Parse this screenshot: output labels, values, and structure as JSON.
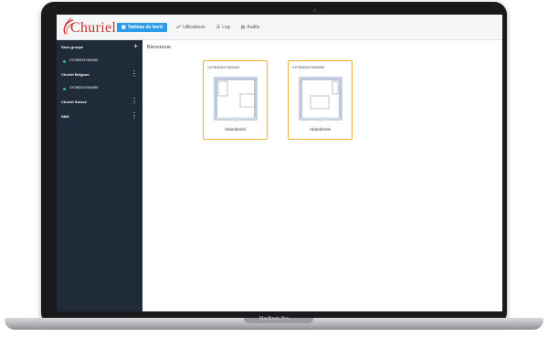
{
  "app": {
    "brand": "Churiel",
    "nav": [
      {
        "label": "Tableau de bord",
        "icon": "dashboard-icon",
        "active": true
      },
      {
        "label": "Utilisateurs",
        "icon": "users-icon",
        "active": false
      },
      {
        "label": "Log",
        "icon": "list-icon",
        "active": false
      },
      {
        "label": "Audits",
        "icon": "audit-icon",
        "active": false
      }
    ]
  },
  "sidebar": {
    "groups": [
      {
        "label": "Sans groupe",
        "action": "+",
        "devices": [
          "VXTB82047500359"
        ]
      },
      {
        "label": "Churiel Belgium",
        "action": "⋮",
        "devices": [
          "VXTB82047500989"
        ]
      },
      {
        "label": "Churiel Suisse",
        "action": "⋮",
        "devices": []
      },
      {
        "label": "SMS",
        "action": "⋮",
        "devices": []
      }
    ],
    "device_status_color": "#34c05a"
  },
  "main": {
    "welcome": "Bienvenue",
    "cards": [
      {
        "title": "VXTB82047500359",
        "status": "Abandonné"
      },
      {
        "title": "VXTB82047500989",
        "status": "Abandonné"
      }
    ],
    "card_border_color": "#f0ad2e"
  },
  "device": {
    "model_label": "MacBook Pro"
  },
  "colors": {
    "accent": "#2c9be8",
    "sidebar_bg": "#1f2b38",
    "brand": "#c8332c"
  }
}
